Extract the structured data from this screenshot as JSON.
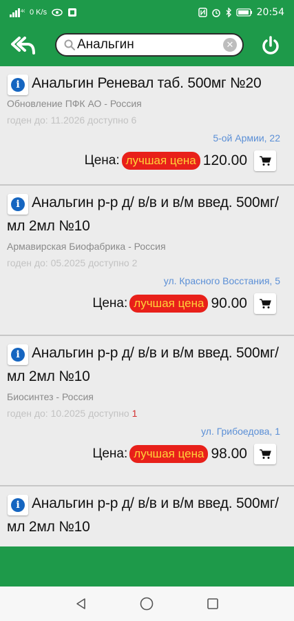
{
  "status_bar": {
    "network_type": "4G",
    "speed": "0 K/s",
    "time": "20:54",
    "battery": "battery-icon"
  },
  "toolbar": {
    "search": {
      "value": "Анальгин",
      "placeholder": ""
    }
  },
  "products": [
    {
      "name": "Анальгин Реневал таб. 500мг №20",
      "maker": "Обновление ПФК АО - Россия",
      "expiry": "годен до: 11.2026 доступно 6",
      "qty_extra": "",
      "address": "5-ой Армии, 22",
      "price_label": "Цена:",
      "badge": "лучшая цена",
      "price": "120.00"
    },
    {
      "name": "Анальгин р-р д/ в/в и в/м введ. 500мг/мл 2мл №10",
      "maker": "Армавирская Биофабрика - Россия",
      "expiry": "годен до: 05.2025 доступно 2",
      "qty_extra": "",
      "address": "ул. Красного Восстания, 5",
      "price_label": "Цена:",
      "badge": "лучшая цена",
      "price": "90.00"
    },
    {
      "name": "Анальгин р-р д/ в/в и в/м введ. 500мг/мл 2мл №10",
      "maker": "Биосинтез - Россия",
      "expiry": "годен до: 10.2025 доступно ",
      "qty_extra": "1",
      "address": "ул. Грибоедова, 1",
      "price_label": "Цена:",
      "badge": "лучшая цена",
      "price": "98.00"
    },
    {
      "name": "Анальгин р-р д/ в/в и в/м введ. 500мг/мл 2мл №10",
      "maker": "",
      "expiry": "",
      "qty_extra": "",
      "address": "",
      "price_label": "",
      "badge": "",
      "price": ""
    }
  ],
  "colors": {
    "brand_green": "#1e9a4a",
    "badge_red": "#e8201a",
    "badge_text": "#ffd23a",
    "address_blue": "#5b8fd6",
    "info_blue": "#1565c0"
  }
}
